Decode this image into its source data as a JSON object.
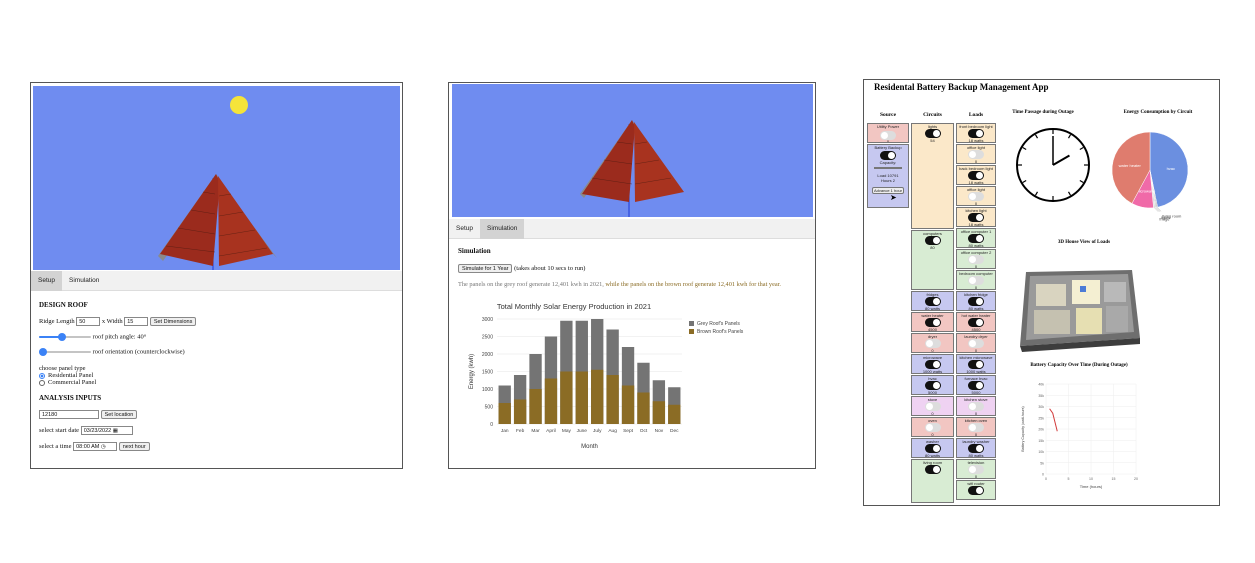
{
  "colors": {
    "sky": "#6f8cf0",
    "sun": "#f5e43a",
    "roof_red": "#9b2b1d",
    "grey_bar": "#747474",
    "brown_bar": "#8b6c25",
    "tab_active": "#d3d3d3"
  },
  "panel1": {
    "tabs": [
      {
        "label": "Setup",
        "active": true
      },
      {
        "label": "Simulation",
        "active": false
      }
    ],
    "design_heading": "DESIGN ROOF",
    "ridge_label": "Ridge Length",
    "ridge_value": "50",
    "width_label": "x Width",
    "width_value": "15",
    "set_dimensions": "Set Dimensions",
    "pitch_label": "roof pitch angle: 40°",
    "pitch_level": 0.45,
    "orientation_label": "roof orientation (counterclockwise)",
    "orientation_level": 0.0,
    "panel_type_label": "choose panel type",
    "panel_options": [
      {
        "label": "Residential Panel",
        "checked": true
      },
      {
        "label": "Commercial Panel",
        "checked": false
      }
    ],
    "analysis_heading": "ANALYSIS INPUTS",
    "zip_value": "12180",
    "set_location": "Set location",
    "start_date_label": "select start date",
    "start_date_value": "03/23/2022",
    "time_label": "select a time",
    "time_value": "08:00 AM",
    "next_hour": "next hour"
  },
  "panel2": {
    "tabs": [
      {
        "label": "Setup",
        "active": false
      },
      {
        "label": "Simulation",
        "active": true
      }
    ],
    "sim_heading": "Simulation",
    "simulate_button": "Simulate for 1 Year",
    "simulate_note": "(takes about 10 secs to run)",
    "result_part1": "The panels on the grey roof generate 12,401 kwh in 2021,",
    "result_part2": " while the panels on the brown roof generate 12,401 kwh for that year."
  },
  "chart_data": {
    "type": "bar",
    "title": "Total Monthly Solar Energy Production in 2021",
    "xlabel": "Month",
    "ylabel": "Energy (kwh)",
    "ylim": [
      0,
      3000
    ],
    "yticks": [
      0,
      500,
      1000,
      1500,
      2000,
      2500,
      3000
    ],
    "legend_position": "top-right",
    "categories": [
      "Jan",
      "Feb",
      "Mar",
      "April",
      "May",
      "June",
      "July",
      "Aug",
      "Sept",
      "Oct",
      "Nov",
      "Dec"
    ],
    "series": [
      {
        "name": "Grey Roof's Panels",
        "values": [
          1100,
          1400,
          2000,
          2500,
          2950,
          2950,
          3000,
          2700,
          2200,
          1750,
          1250,
          1050
        ]
      },
      {
        "name": "Brown Roof's Panels",
        "values": [
          600,
          700,
          1000,
          1300,
          1500,
          1500,
          1550,
          1400,
          1100,
          900,
          650,
          550
        ]
      }
    ]
  },
  "panel3": {
    "title": "Residental Battery Backup Management App",
    "headers": {
      "source": "Source",
      "circuits": "Circuits",
      "loads": "Loads"
    },
    "source": {
      "utility_label": "Utility Power",
      "utility_value": "0",
      "battery_label": "Battery Backup",
      "capacity_label": "Capacity:",
      "load_text": "Load 10791",
      "hours_text": "Hours 2",
      "advance_button": "Advance 1 hour"
    },
    "circuits": [
      {
        "name": "lights",
        "value": "54",
        "on": true
      },
      {
        "name": "computers",
        "value": "80",
        "on": true
      },
      {
        "name": "fridges",
        "value": "80 watts",
        "on": true
      },
      {
        "name": "water heater",
        "value": "4500",
        "on": true
      },
      {
        "name": "dryer",
        "value": "0",
        "on": false
      },
      {
        "name": "microwave",
        "value": "1000 watts",
        "on": true
      },
      {
        "name": "hvac",
        "value": "5000",
        "on": true
      },
      {
        "name": "stove",
        "value": "0",
        "on": false
      },
      {
        "name": "oven",
        "value": "0",
        "on": false
      },
      {
        "name": "washer",
        "value": "80 watts",
        "on": true
      },
      {
        "name": "living room",
        "value": "",
        "on": true
      }
    ],
    "loads": [
      {
        "name": "front bedroom light",
        "value": "18 watts",
        "on": true
      },
      {
        "name": "office light",
        "value": "0",
        "on": false
      },
      {
        "name": "back bedroom light",
        "value": "18 watts",
        "on": true
      },
      {
        "name": "office light",
        "value": "0",
        "on": false
      },
      {
        "name": "kitchen light",
        "value": "18 watts",
        "on": true
      },
      {
        "name": "office computer 1",
        "value": "80 watts",
        "on": true
      },
      {
        "name": "office computer 2",
        "value": "0",
        "on": false
      },
      {
        "name": "bedroom computer",
        "value": "0",
        "on": false
      },
      {
        "name": "kitchen fridge",
        "value": "80 watts",
        "on": true
      },
      {
        "name": "hot water heater",
        "value": "4500",
        "on": true
      },
      {
        "name": "laundry dryer",
        "value": "0",
        "on": false
      },
      {
        "name": "kitchen microwave",
        "value": "1000 watts",
        "on": true
      },
      {
        "name": "furnace hvac",
        "value": "5000",
        "on": true
      },
      {
        "name": "kitchen stove",
        "value": "0",
        "on": false
      },
      {
        "name": "kitchen oven",
        "value": "0",
        "on": false
      },
      {
        "name": "laundry washer",
        "value": "80 watts",
        "on": true
      },
      {
        "name": "television",
        "value": "0",
        "on": false
      },
      {
        "name": "wifi router",
        "value": "",
        "on": true
      }
    ],
    "clock_title": "Time Passage during Outage",
    "clock_time": {
      "hour": 2,
      "minute": 0
    },
    "pie_title": "Energy Consumption by Circuit",
    "pie": [
      {
        "label": "hvac",
        "value": 5000,
        "color": "#6b8fe0"
      },
      {
        "label": "living room",
        "value": 50,
        "color": "#9e9e9e"
      },
      {
        "label": "lights",
        "value": 54,
        "color": "#c0c0c0"
      },
      {
        "label": "fridge",
        "value": 80,
        "color": "#d9d9d9"
      },
      {
        "label": "microwave",
        "value": 1000,
        "color": "#f06aa8"
      },
      {
        "label": "water heater",
        "value": 4500,
        "color": "#df7c6e"
      }
    ],
    "house_title": "3D House View of Loads",
    "battery_title": "Battery Capacity Over Time (During Outage)",
    "battery_xlabel": "Time (hours)",
    "battery_ylabel": "Battery Capacity (watt-hours)",
    "battery_xticks": [
      "0",
      "5",
      "10",
      "15",
      "20"
    ],
    "battery_yticks": [
      "0",
      "5k",
      "10k",
      "15k",
      "20k",
      "25k",
      "30k",
      "35k",
      "40k"
    ],
    "battery_points": [
      [
        0.8,
        29000
      ],
      [
        1.5,
        27000
      ],
      [
        2.0,
        23000
      ],
      [
        2.5,
        19000
      ]
    ]
  }
}
